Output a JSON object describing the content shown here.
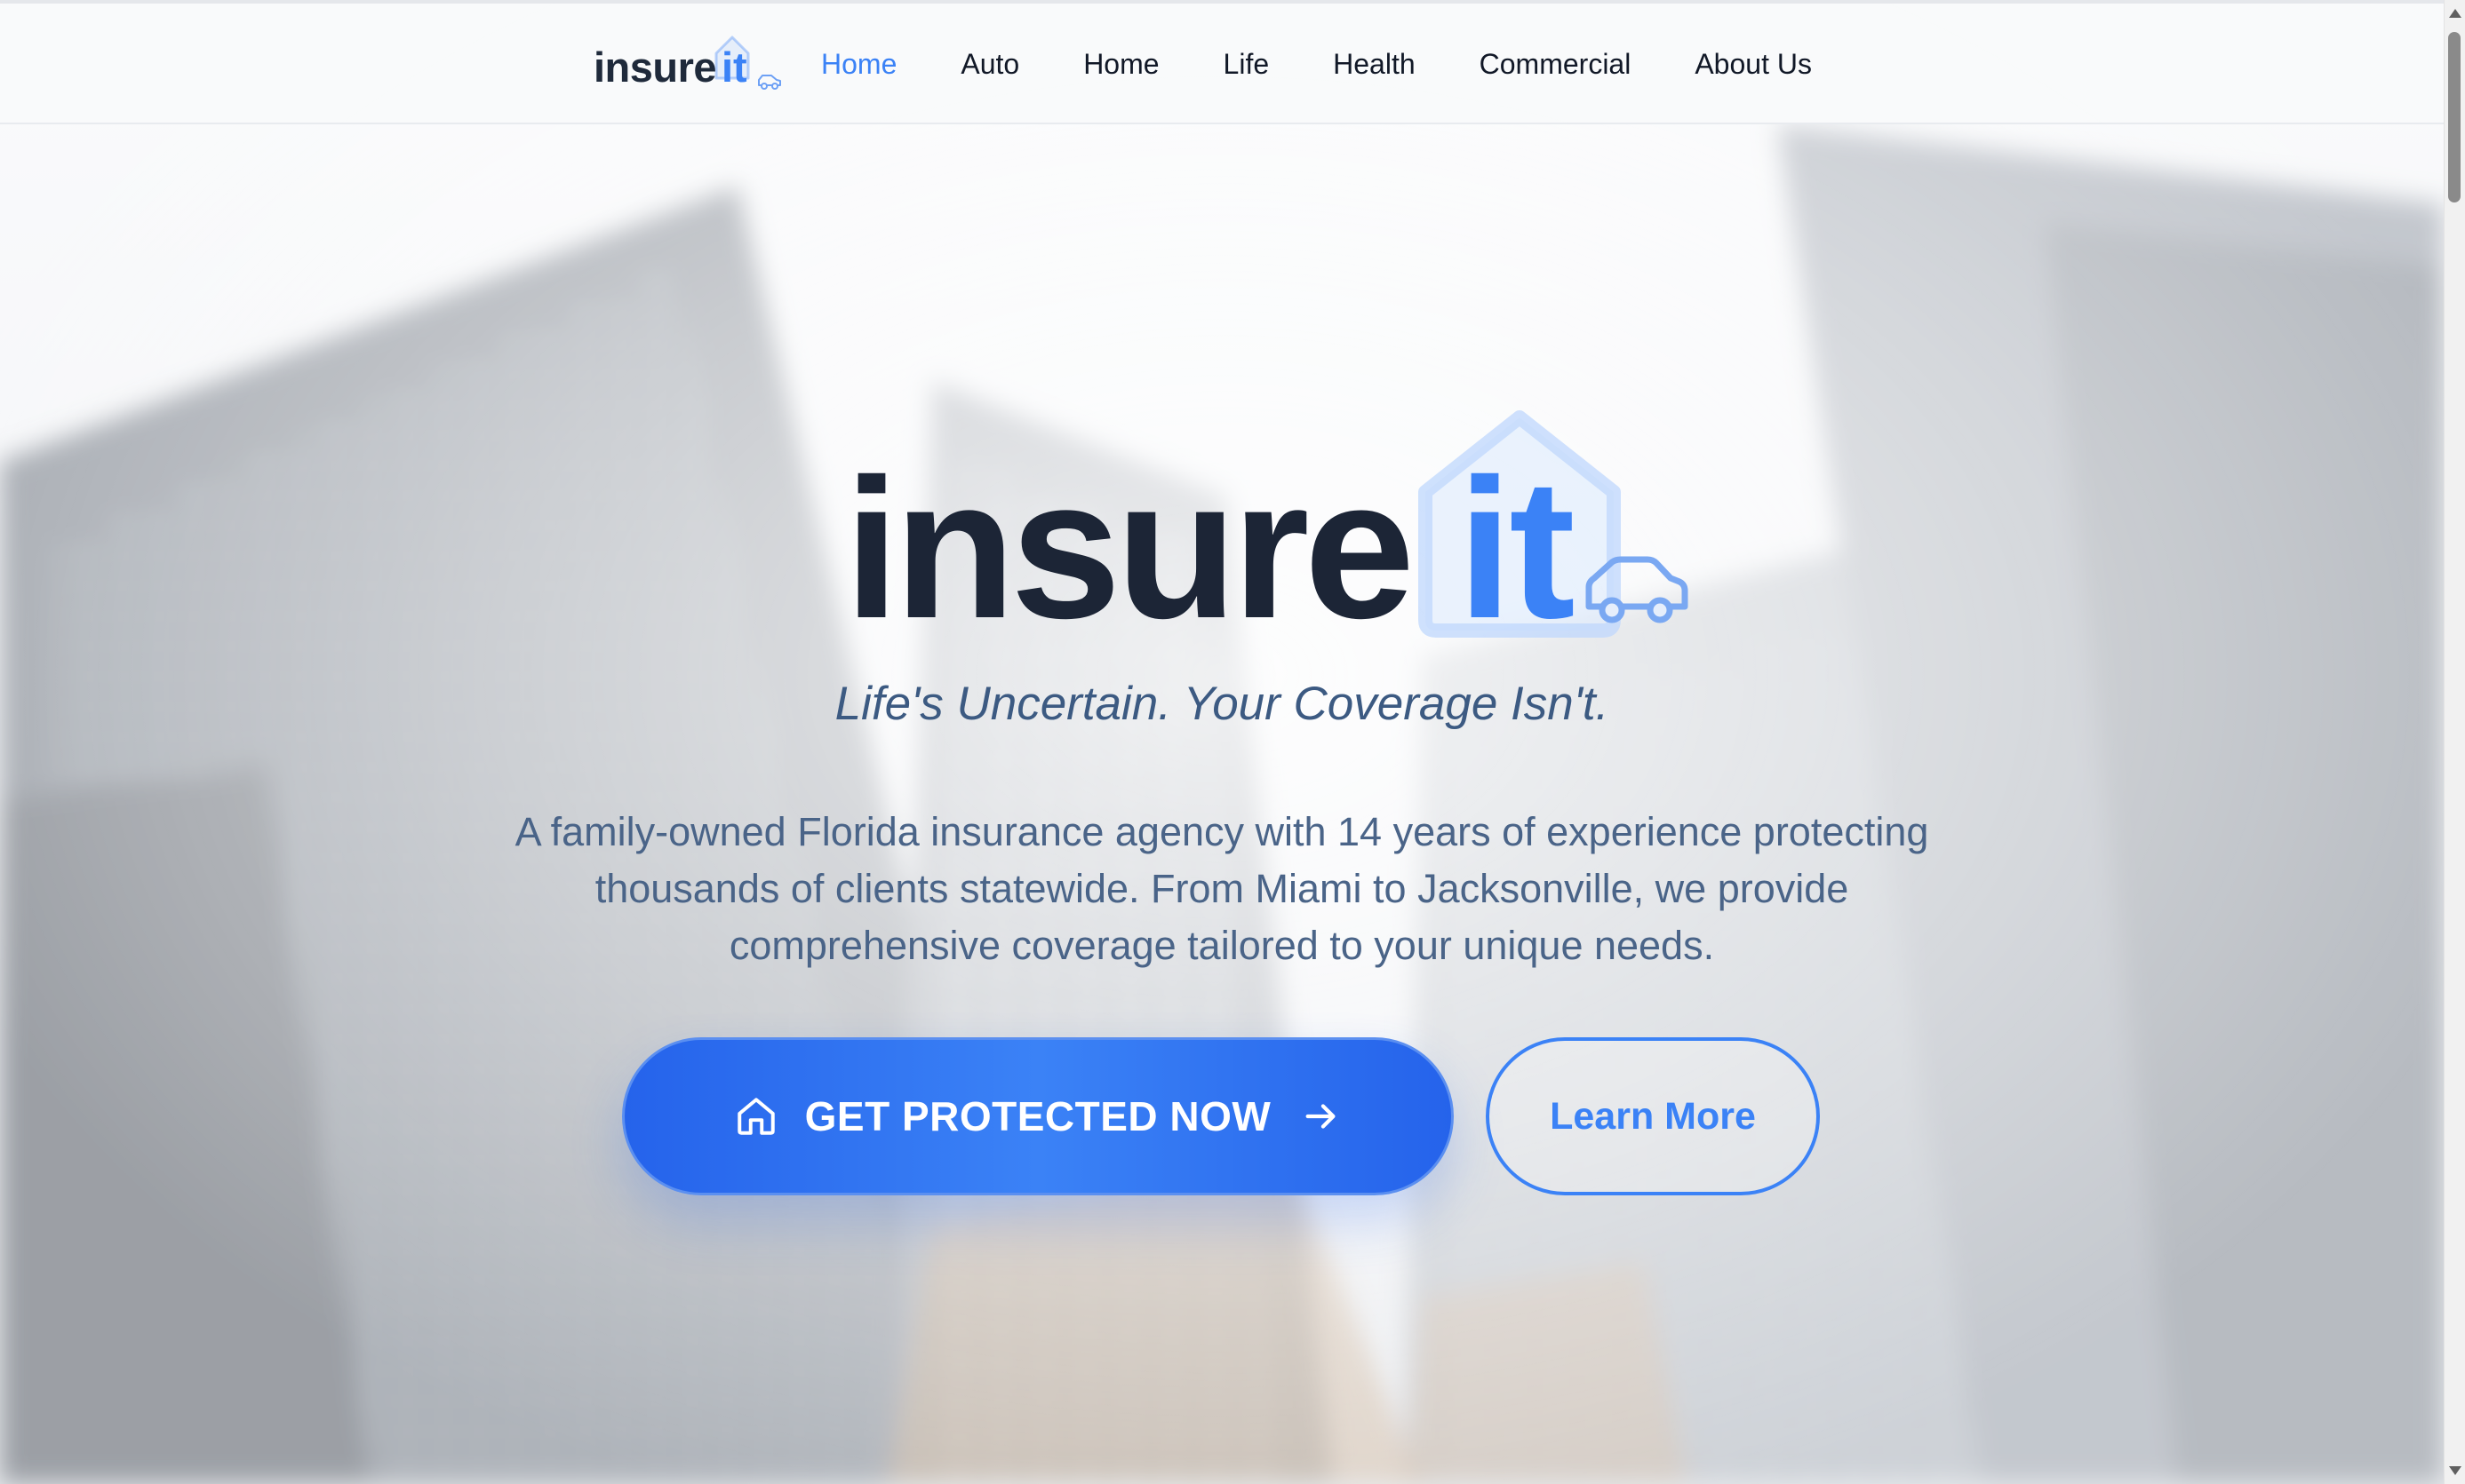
{
  "brand": {
    "word": "insure",
    "accent_word": "it",
    "text_color": "#1c2536",
    "accent_color": "#3b82f6"
  },
  "nav": {
    "items": [
      {
        "label": "Home",
        "active": true
      },
      {
        "label": "Auto",
        "active": false
      },
      {
        "label": "Home",
        "active": false
      },
      {
        "label": "Life",
        "active": false
      },
      {
        "label": "Health",
        "active": false
      },
      {
        "label": "Commercial",
        "active": false
      },
      {
        "label": "About Us",
        "active": false
      }
    ]
  },
  "hero": {
    "tagline": "Life's Uncertain. Your Coverage Isn't.",
    "description": "A family-owned Florida insurance agency with 14 years of experience protecting thousands of clients statewide. From Miami to Jacksonville, we provide comprehensive coverage tailored to your unique needs.",
    "primary_cta": {
      "label": "GET PROTECTED NOW",
      "icon_left": "home-icon",
      "icon_right": "arrow-right-icon"
    },
    "secondary_cta": {
      "label": "Learn More"
    },
    "background": "blurred-skyscrapers-image"
  },
  "colors": {
    "accent": "#3b82f6",
    "primary_button": "#2563eb",
    "tagline": "#3c5a82",
    "description": "#4a6488"
  }
}
